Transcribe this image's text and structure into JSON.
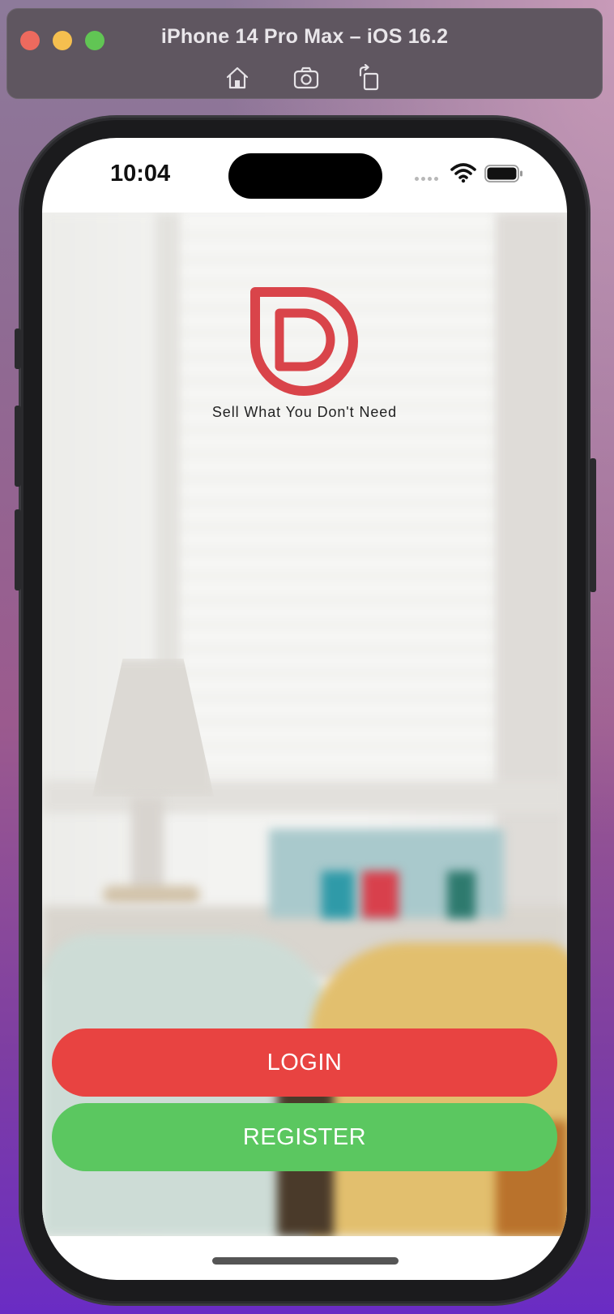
{
  "simulator": {
    "title": "iPhone 14 Pro Max – iOS 16.2",
    "toolbar": [
      {
        "icon": "home-icon"
      },
      {
        "icon": "screenshot-icon"
      },
      {
        "icon": "rotate-icon"
      }
    ]
  },
  "status_bar": {
    "time": "10:04",
    "icons": [
      "signal-dots-icon",
      "wifi-icon",
      "battery-icon"
    ]
  },
  "app": {
    "logo": "app-logo-icon",
    "tagline": "Sell What You Don't Need",
    "login_label": "LOGIN",
    "register_label": "REGISTER"
  },
  "colors": {
    "login": "#e84341",
    "register": "#5bc760",
    "brand": "#d9444a"
  }
}
